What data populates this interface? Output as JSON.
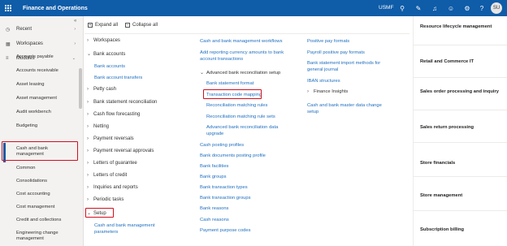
{
  "header": {
    "app_title": "Finance and Operations",
    "company": "USMF",
    "avatar": "SU"
  },
  "nav": {
    "top": [
      {
        "label": "Recent",
        "icon": "clock-icon"
      },
      {
        "label": "Workspaces",
        "icon": "workspace-icon"
      },
      {
        "label": "Modules",
        "icon": "list-icon"
      }
    ],
    "modules": [
      "Accounts payable",
      "Accounts receivable",
      "Asset leasing",
      "Asset management",
      "Audit workbench",
      "Budgeting",
      "Cash and bank management",
      "Common",
      "Consolidations",
      "Cost accounting",
      "Cost management",
      "Credit and collections",
      "Engineering change management"
    ]
  },
  "toolbar": {
    "expand": "Expand all",
    "collapse": "Collapse all"
  },
  "groups": [
    "Workspaces",
    "Bank accounts",
    "Petty cash",
    "Bank statement reconciliation",
    "Cash flow forecasting",
    "Netting",
    "Payment reversals",
    "Payment reversal approvals",
    "Letters of guarantee",
    "Letters of credit",
    "Inquiries and reports",
    "Periodic tasks",
    "Setup"
  ],
  "bank_accounts_links": [
    "Bank accounts",
    "Bank account transfers"
  ],
  "setup_link": "Cash and bank management parameters",
  "middle": {
    "top_links": [
      "Cash and bank management workflows",
      "Add reporting currency amounts to bank account transactions"
    ],
    "adv_header": "Advanced bank reconciliation setup",
    "adv_links": [
      "Bank statement format",
      "Transaction code mapping",
      "Reconciliation matching rules",
      "Reconciliation matching rule sets",
      "Advanced bank reconciliation data upgrade"
    ],
    "links": [
      "Cash posting profiles",
      "Bank documents posting profile",
      "Bank facilities",
      "Bank groups",
      "Bank transaction types",
      "Bank transaction groups",
      "Bank reasons",
      "Cash reasons",
      "Payment purpose codes"
    ]
  },
  "right": {
    "links": [
      "Positive pay formats",
      "Payroll positive pay formats",
      "Bank statement import methods for general journal",
      "IBAN structures"
    ],
    "finance_insights": "Finance Insights",
    "bottom_link": "Cash and bank master data change setup"
  },
  "tiles": [
    "Resource lifecycle management",
    "Retail and Commerce IT",
    "Sales order processing and inquiry",
    "Sales return processing",
    "Store financials",
    "Store management",
    "Subscription billing"
  ],
  "colors": {
    "header": "#0f5ca8",
    "link": "#1f6fbf",
    "highlight": "#d20f1d"
  }
}
